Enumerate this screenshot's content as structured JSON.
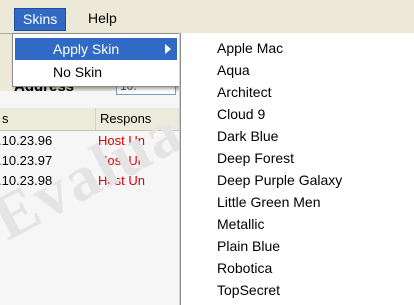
{
  "menubar": {
    "items": [
      {
        "label": "Skins"
      },
      {
        "label": "Help"
      }
    ]
  },
  "toolbar": {
    "address_label": "Address",
    "address_value": "10."
  },
  "list": {
    "columns": [
      {
        "label": "s"
      },
      {
        "label": "Respons"
      }
    ],
    "rows": [
      {
        "ip": ".10.23.96",
        "status": "Host Un"
      },
      {
        "ip": ".10.23.97",
        "status": "Host Un"
      },
      {
        "ip": ".10.23.98",
        "status": "Host Un"
      }
    ]
  },
  "watermark": {
    "text": "Evaluation Version"
  },
  "skins_menu": {
    "items": [
      {
        "label": "Apply Skin",
        "highlighted": true,
        "has_submenu": true
      },
      {
        "label": "No Skin",
        "highlighted": false,
        "has_submenu": false
      }
    ]
  },
  "apply_skin_submenu": {
    "items": [
      {
        "label": "Apple Mac"
      },
      {
        "label": "Aqua"
      },
      {
        "label": "Architect"
      },
      {
        "label": "Cloud 9"
      },
      {
        "label": "Dark Blue"
      },
      {
        "label": "Deep Forest"
      },
      {
        "label": "Deep Purple Galaxy"
      },
      {
        "label": "Little Green Men"
      },
      {
        "label": "Metallic"
      },
      {
        "label": "Plain Blue"
      },
      {
        "label": "Robotica"
      },
      {
        "label": "TopSecret"
      }
    ]
  },
  "colors": {
    "highlight": "#316ac5",
    "status_error": "#e00000"
  }
}
